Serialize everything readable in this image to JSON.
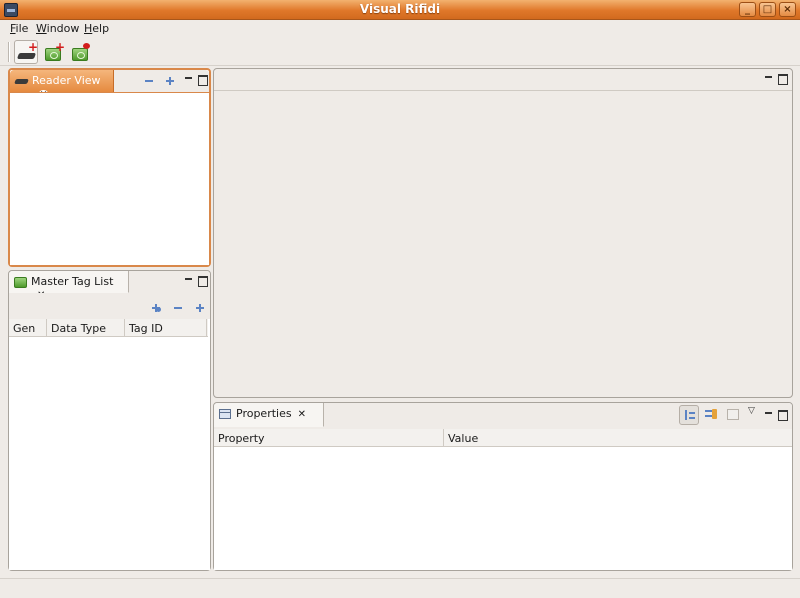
{
  "window": {
    "title": "Visual Rifidi",
    "controls": [
      "minimize",
      "maximize",
      "close"
    ]
  },
  "menu": {
    "items": [
      {
        "label": "File",
        "mnemonic": "F",
        "rest": "ile"
      },
      {
        "label": "Window",
        "mnemonic": "W",
        "rest": "indow"
      },
      {
        "label": "Help",
        "mnemonic": "H",
        "rest": "elp"
      }
    ]
  },
  "toolbar": {
    "buttons": [
      {
        "icon": "add-reader-icon"
      },
      {
        "icon": "add-tag-icon"
      },
      {
        "icon": "remove-tag-icon"
      }
    ]
  },
  "reader_view": {
    "tab_label": "Reader View"
  },
  "master_tag_list": {
    "tab_label": "Master Tag List",
    "columns": [
      "Gen",
      "Data Type",
      "Tag ID"
    ]
  },
  "properties": {
    "tab_label": "Properties",
    "columns": [
      "Property",
      "Value"
    ]
  },
  "colors": {
    "accent": "#e58a3f",
    "titlebar": "#e0782a",
    "panel_bg": "#efebe7"
  }
}
